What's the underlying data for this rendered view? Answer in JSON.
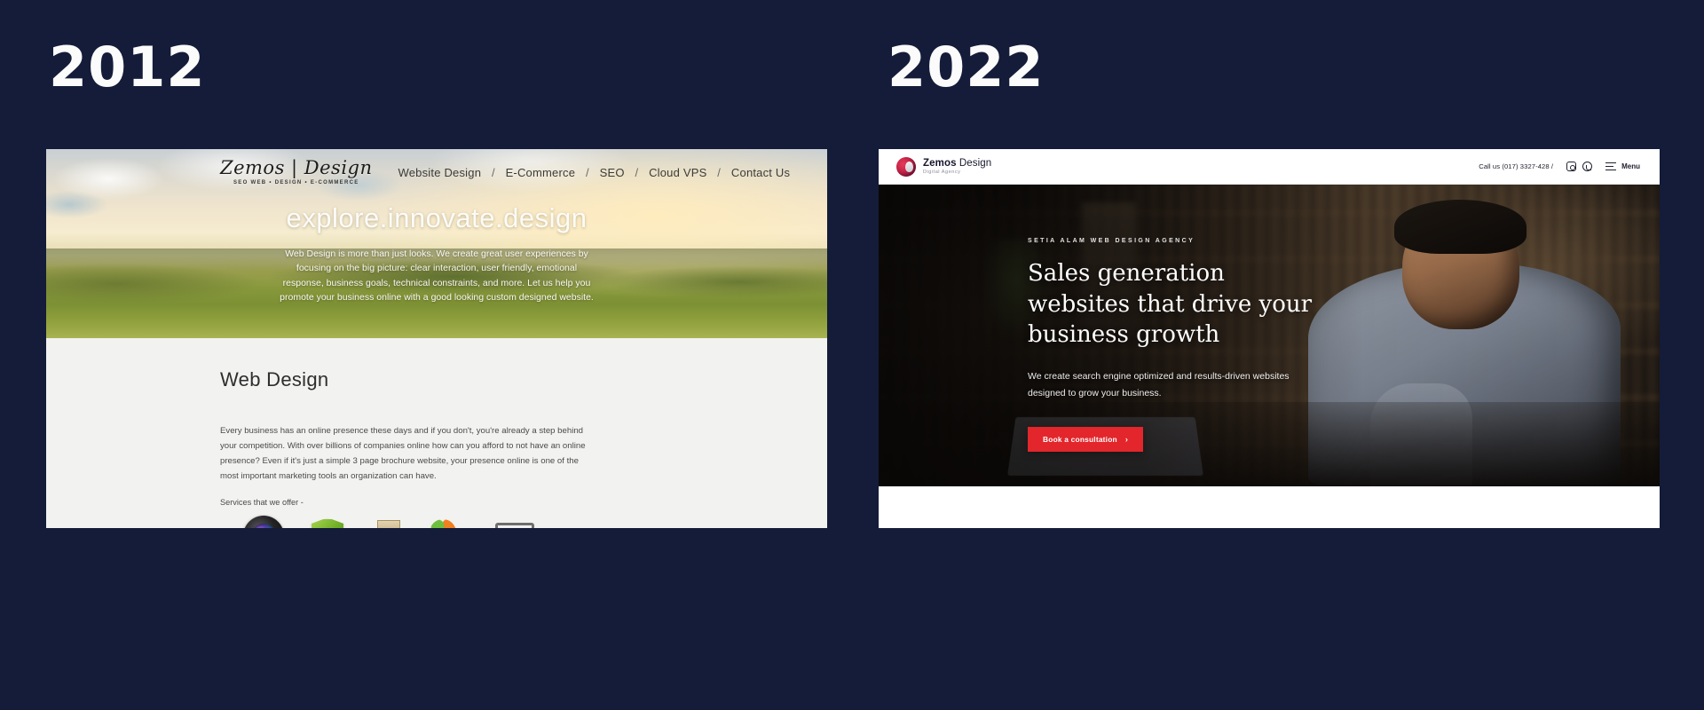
{
  "page": {
    "background_color": "#141c3a",
    "left_year": "2012",
    "right_year": "2022"
  },
  "site_2012": {
    "logo": {
      "name": "Zemos | Design",
      "tagline": "SEO WEB  •  DESIGN  •  E-COMMERCE"
    },
    "nav": [
      "Website Design",
      "E-Commerce",
      "SEO",
      "Cloud VPS",
      "Contact Us"
    ],
    "nav_separator": "/",
    "hero": {
      "title": "explore.innovate.design",
      "paragraph": "Web Design is more than just looks. We create great user experiences by focusing on the big picture: clear interaction, user friendly, emotional response, business goals, technical constraints, and more. Let us help you promote your business online with a good looking custom designed website."
    },
    "section": {
      "heading": "Web Design",
      "paragraph": "Every business has an online presence these days and if you don't, you're already a step behind your competition. With over billions of companies online how can you afford to not have an online presence? Even if it's just a simple 3 page brochure website, your presence online is one of the most important marketing tools an organization can have.",
      "services_label": "Services that we offer -",
      "service_icons": [
        "camera-lens-icon",
        "green-shield-icon",
        "shopping-basket-icon",
        "cms-joomla-wordpress-icon",
        "multimedia-music-icon"
      ]
    }
  },
  "site_2022": {
    "header": {
      "brand_name_bold": "Zemos",
      "brand_name_light": " Design",
      "brand_tagline": "Digital Agency",
      "call_us": "Call us (017) 3327-428  /",
      "social_icons": [
        "instagram-icon",
        "whatsapp-icon"
      ],
      "menu_label": "Menu"
    },
    "hero": {
      "eyebrow": "SETIA ALAM WEB DESIGN AGENCY",
      "heading": "Sales generation websites that drive your business growth",
      "subheading": "We create search engine optimized and results-driven websites designed to grow your business.",
      "cta_label": "Book a consultation",
      "cta_chevron": "›",
      "cta_color": "#e2262c"
    }
  }
}
